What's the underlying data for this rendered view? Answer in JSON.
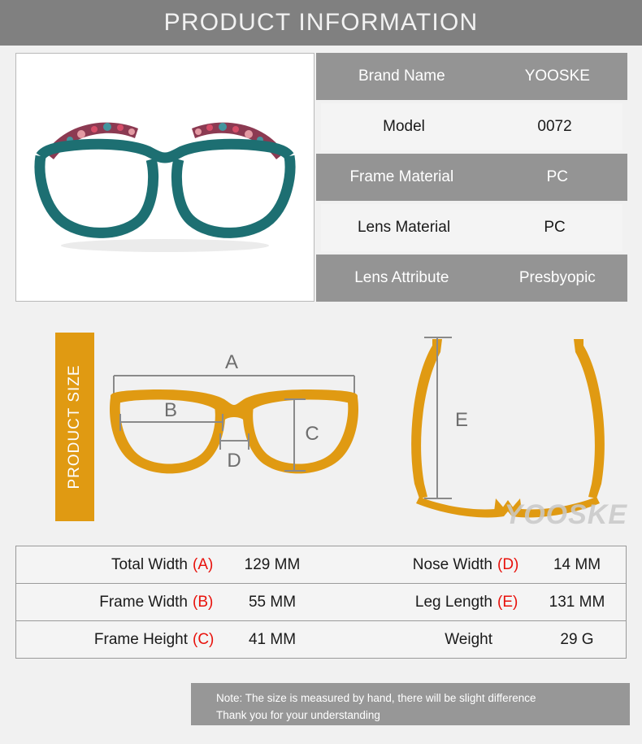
{
  "header": {
    "title": "PRODUCT INFORMATION"
  },
  "product_photo": {
    "alt": "teal eyeglasses with floral patterned temples",
    "frame_color": "#1d6f72",
    "temple_pattern_colors": [
      "#d94f6a",
      "#8c3a52",
      "#3f9aa3",
      "#e8a0a8"
    ]
  },
  "spec_table": {
    "rows": [
      {
        "label": "Brand Name",
        "value": "YOOSKE"
      },
      {
        "label": "Model",
        "value": "0072"
      },
      {
        "label": "Frame Material",
        "value": "PC"
      },
      {
        "label": "Lens Material",
        "value": "PC"
      },
      {
        "label": "Lens Attribute",
        "value": "Presbyopic"
      }
    ]
  },
  "size_section": {
    "band_label": "PRODUCT SIZE",
    "watermark": "YOOSKE",
    "front_view_markers": [
      "A",
      "B",
      "C",
      "D"
    ],
    "side_view_markers": [
      "E"
    ],
    "marker_A": "A",
    "marker_B": "B",
    "marker_C": "C",
    "marker_D": "D",
    "marker_E": "E"
  },
  "measure_table": {
    "rows": [
      {
        "left": {
          "name": "Total Width",
          "key": "(A)",
          "value": "129 MM"
        },
        "right": {
          "name": "Nose Width",
          "key": "(D)",
          "value": "14 MM"
        }
      },
      {
        "left": {
          "name": "Frame Width",
          "key": "(B)",
          "value": "55 MM"
        },
        "right": {
          "name": "Leg Length",
          "key": "(E)",
          "value": "131 MM"
        }
      },
      {
        "left": {
          "name": "Frame Height",
          "key": "(C)",
          "value": "41 MM"
        },
        "right": {
          "name": "Weight",
          "key": "",
          "value": "29 G"
        }
      }
    ]
  },
  "note": {
    "line1": "Note: The size is measured by hand, there will be slight difference",
    "line2": "Thank you for your understanding"
  },
  "colors": {
    "header_gray": "#808080",
    "row_gray": "#949494",
    "row_light": "#f4f4f4",
    "orange": "#e09a12",
    "marker_red": "#e8120c",
    "page_bg": "#f1f1f1",
    "dimension_line": "#8a8a8a"
  }
}
